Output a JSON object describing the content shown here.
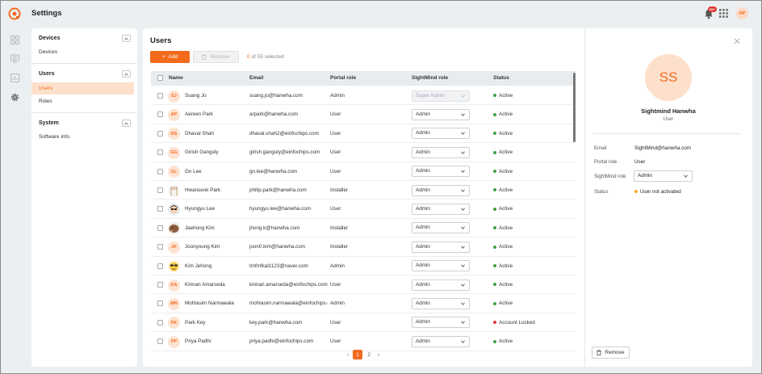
{
  "app": {
    "title": "Settings",
    "notification_count": "99+",
    "user_initials": "HP"
  },
  "nav": {
    "sections": [
      {
        "title": "Devices",
        "items": [
          {
            "label": "Devices",
            "active": false
          }
        ]
      },
      {
        "title": "Users",
        "items": [
          {
            "label": "Users",
            "active": true
          },
          {
            "label": "Roles",
            "active": false
          }
        ]
      },
      {
        "title": "System",
        "items": [
          {
            "label": "Software info",
            "active": false
          }
        ]
      }
    ]
  },
  "main": {
    "title": "Users",
    "add_label": "Add",
    "remove_label": "Remove",
    "selected_count": "0",
    "selected_suffix": "of 55 selected",
    "columns": {
      "name": "Name",
      "email": "Email",
      "portal_role": "Portal role",
      "sightmind_role": "SightMind role",
      "status": "Status"
    },
    "rows": [
      {
        "initials": "SJ",
        "avatar": "initials",
        "name": "Suang Jo",
        "email": "suang.jo@hanwha.com",
        "portal_role": "Admin",
        "sightmind_role": "Super Admin",
        "role_disabled": true,
        "status": "Active",
        "status_color": "#43a047"
      },
      {
        "initials": "AP",
        "avatar": "initials",
        "name": "Aereen Park",
        "email": "arpark@hanwha.com",
        "portal_role": "User",
        "sightmind_role": "Admin",
        "role_disabled": false,
        "status": "Active",
        "status_color": "#43a047"
      },
      {
        "initials": "DS",
        "avatar": "initials",
        "name": "Dhaval Shah",
        "email": "dhaval.shah2@einfochips.com",
        "portal_role": "User",
        "sightmind_role": "Admin",
        "role_disabled": false,
        "status": "Active",
        "status_color": "#43a047"
      },
      {
        "initials": "GG",
        "avatar": "initials",
        "name": "Girish Ganguly",
        "email": "girish.ganguly@einfochips.com",
        "portal_role": "User",
        "sightmind_role": "Admin",
        "role_disabled": false,
        "status": "Active",
        "status_color": "#43a047"
      },
      {
        "initials": "GL",
        "avatar": "initials",
        "name": "Gn Lee",
        "email": "gn.lee@hanwha.com",
        "portal_role": "User",
        "sightmind_role": "Admin",
        "role_disabled": false,
        "status": "Active",
        "status_color": "#43a047"
      },
      {
        "initials": "",
        "avatar": "photo-gate",
        "name": "Hwanseok Park",
        "email": "philip.park@hanwha.com",
        "portal_role": "Installer",
        "sightmind_role": "Admin",
        "role_disabled": false,
        "status": "Active",
        "status_color": "#43a047"
      },
      {
        "initials": "",
        "avatar": "photo-cartoon",
        "name": "Hyungyu Lee",
        "email": "hyungyu.lee@hanwha.com",
        "portal_role": "User",
        "sightmind_role": "Admin",
        "role_disabled": false,
        "status": "Active",
        "status_color": "#43a047"
      },
      {
        "initials": "",
        "avatar": "photo-mammoth",
        "name": "Jaehong Kim",
        "email": "jhong.k@hanwha.com",
        "portal_role": "Installer",
        "sightmind_role": "Admin",
        "role_disabled": false,
        "status": "Active",
        "status_color": "#43a047"
      },
      {
        "initials": "JK",
        "avatar": "initials",
        "name": "Joonyoung Kim",
        "email": "joon0.kim@hanwha.com",
        "portal_role": "Installer",
        "sightmind_role": "Admin",
        "role_disabled": false,
        "status": "Active",
        "status_color": "#43a047"
      },
      {
        "initials": "",
        "avatar": "photo-emoji",
        "name": "Kim Jehong",
        "email": "tmfmfkal1123@naver.com",
        "portal_role": "Admin",
        "sightmind_role": "Admin",
        "role_disabled": false,
        "status": "Active",
        "status_color": "#43a047"
      },
      {
        "initials": "KA",
        "avatar": "initials",
        "name": "Kinnari Amarseda",
        "email": "kinnari.amarseda@einfochips.com",
        "portal_role": "User",
        "sightmind_role": "Admin",
        "role_disabled": false,
        "status": "Active",
        "status_color": "#43a047"
      },
      {
        "initials": "MN",
        "avatar": "initials",
        "name": "Mohtasim Narmawala",
        "email": "mohtasim.narmawala@einfochips.com",
        "portal_role": "Admin",
        "sightmind_role": "Admin",
        "role_disabled": false,
        "status": "Active",
        "status_color": "#43a047"
      },
      {
        "initials": "PK",
        "avatar": "initials",
        "name": "Park Key",
        "email": "key.park@hanwha.com",
        "portal_role": "User",
        "sightmind_role": "Admin",
        "role_disabled": false,
        "status": "Account Locked",
        "status_color": "#e53935"
      },
      {
        "initials": "PP",
        "avatar": "initials",
        "name": "Priya Padhi",
        "email": "priya.padhi@einfochips.com",
        "portal_role": "User",
        "sightmind_role": "Admin",
        "role_disabled": false,
        "status": "Active",
        "status_color": "#43a047"
      }
    ],
    "pagination": {
      "pages": [
        "1",
        "2"
      ],
      "current": "1"
    }
  },
  "detail": {
    "initials": "SS",
    "name": "Sightmind Hanwha",
    "role": "User",
    "email_label": "Email",
    "email": "SightMind@hanwha.com",
    "portal_role_label": "Portal role",
    "portal_role": "User",
    "sightmind_role_label": "SightMind role",
    "sightmind_role": "Admin",
    "status_label": "Status",
    "status": "User not activated",
    "status_color": "#f9a825",
    "remove_label": "Remove"
  },
  "colors": {
    "accent": "#f26b1d",
    "active": "#43a047",
    "locked": "#e53935",
    "pending": "#f9a825"
  }
}
